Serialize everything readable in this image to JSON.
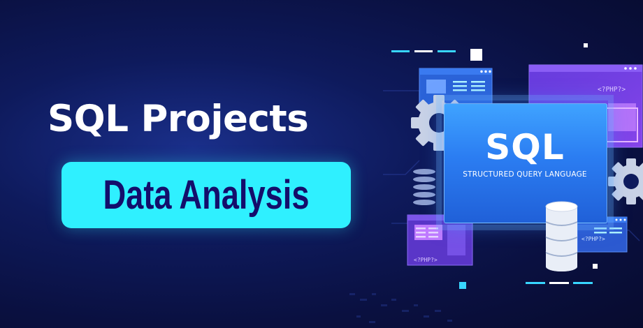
{
  "headline": "SQL Projects",
  "badge": "Data Analysis",
  "illustration": {
    "main_title": "SQL",
    "main_subtitle": "STRUCTURED QUERY LANGUAGE",
    "tag_top_right": "<?PHP?>",
    "tag_bottom_left": "<?PHP?>",
    "tag_bottom_right": "<?PHP?>"
  },
  "colors": {
    "background": "#0e1a5c",
    "badge": "#2ff0ff",
    "badge_text": "#140e6b",
    "panel_blue": "#2b7df2",
    "panel_purple": "#7b3ff0"
  }
}
